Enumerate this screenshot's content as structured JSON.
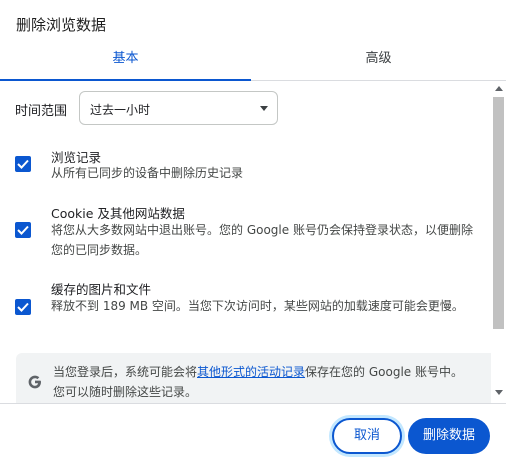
{
  "dialog": {
    "title": "删除浏览数据"
  },
  "tabs": [
    {
      "label": "基本",
      "selected": true
    },
    {
      "label": "高级",
      "selected": false
    }
  ],
  "time_range": {
    "label": "时间范围",
    "value": "过去一小时"
  },
  "options": [
    {
      "title": "浏览记录",
      "description": "从所有已同步的设备中删除历史记录",
      "checked": true
    },
    {
      "title": "Cookie 及其他网站数据",
      "description": "将您从大多数网站中退出账号。您的 Google 账号仍会保持登录状态，以便删除您的已同步数据。",
      "checked": true
    },
    {
      "title": "缓存的图片和文件",
      "description": "释放不到 189 MB 空间。当您下次访问时，某些网站的加载速度可能会更慢。",
      "checked": true
    }
  ],
  "info": {
    "icon": "google-g-icon",
    "text_before": "当您登录后，系统可能会将",
    "link_text": "其他形式的活动记录",
    "text_after": "保存在您的 Google 账号中。您可以随时删除这些记录。"
  },
  "buttons": {
    "cancel": "取消",
    "delete": "删除数据"
  },
  "colors": {
    "accent": "#0b57d0",
    "text": "#202124",
    "secondary_text": "#444746",
    "info_bg": "#f1f3f4"
  }
}
